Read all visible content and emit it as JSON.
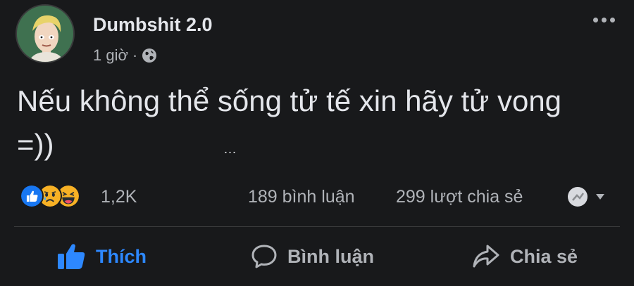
{
  "post": {
    "author": "Dumbshit 2.0",
    "time": "1 giờ",
    "separator": "·",
    "audience_icon": "globe-icon",
    "text": "Nếu không thể sống tử tế xin hãy tử vong =))",
    "see_more": "...",
    "reactions": {
      "icons": [
        "like-reaction-icon",
        "sad-reaction-icon",
        "haha-reaction-icon"
      ],
      "count": "1,2K"
    },
    "comments_count": "189 bình luận",
    "shares_count": "299 lượt chia sẻ"
  },
  "actions": {
    "like": "Thích",
    "comment": "Bình luận",
    "share": "Chia sẻ"
  },
  "colors": {
    "background": "#18191b",
    "text": "#e4e6eb",
    "secondary_text": "#b0b3b8",
    "like_blue": "#2d88ff"
  }
}
